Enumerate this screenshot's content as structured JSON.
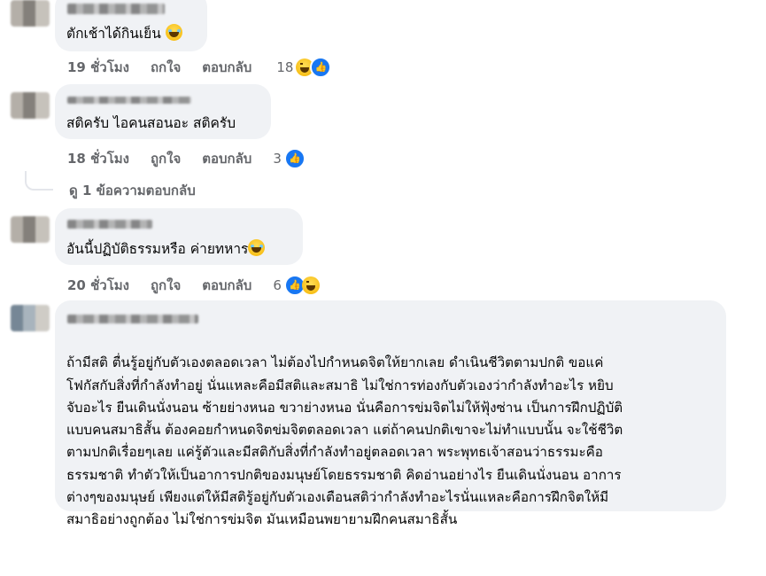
{
  "comments": [
    {
      "text": "ตักเช้าได้กินเย็น",
      "time": "19 ชั่วโมง",
      "like": "ถกใจ",
      "reply": "ตอบกลับ",
      "reactions_count": "18",
      "reactions": [
        "laugh-icon",
        "like-icon"
      ]
    },
    {
      "text": "สติครับ ไอคนสอนอะ สติครับ",
      "time": "18 ชั่วโมง",
      "like": "ถูกใจ",
      "reply": "ตอบกลับ",
      "reactions_count": "3",
      "reactions": [
        "like-icon"
      ]
    },
    {
      "text": "อันนี้ปฏิบัติธรรมหรือ ค่ายทหาร",
      "time": "20 ชั่วโมง",
      "like": "ถูกใจ",
      "reply": "ตอบกลับ",
      "reactions_count": "6",
      "reactions": [
        "like-icon",
        "laugh-icon"
      ]
    },
    {
      "lines": [
        "ถ้ามีสติ ตื่นรู้อยู่กับตัวเองตลอดเวลา ไม่ต้องไปกำหนดจิตให้ยากเลย ดำเนินชีวิตตามปกติ ขอแค่",
        "โฟกัสกับสิ่งที่กำลังทำอยู่ นั่นแหละคือมีสติและสมาธิ ไม่ใช่การท่องกับตัวเองว่ากำลังทำอะไร หยิบ",
        "จับอะไร ยืนเดินนั่งนอน ซ้ายย่างหนอ ขวาย่างหนอ นั่นคือการข่มจิตไม่ให้ฟุ้งซ่าน เป็นการฝึกปฏิบัติ",
        "แบบคนสมาธิสั้น ต้องคอยกำหนดจิตข่มจิตตลอดเวลา แต่ถ้าคนปกติเขาจะไม่ทำแบบนั้น จะใช้ชีวิต",
        "ตามปกติเรื่อยๆเลย แค่รู้ตัวและมีสติกับสิ่งที่กำลังทำอยู่ตลอดเวลา พระพุทธเจ้าสอนว่าธรรมะคือ",
        "ธรรมชาติ ทำตัวให้เป็นอาการปกติของมนุษย์โดยธรรมชาติ คิดอ่านอย่างไร ยืนเดินนั่งนอน อาการ",
        "ต่างๆของมนุษย์ เพียงแต่ให้มีสติรู้อยู่กับตัวเองเตือนสติว่ากำลังทำอะไรนั่นแหละคือการฝึกจิตให้มี",
        "สมาธิอย่างถูกต้อง ไม่ใช่การข่มจิต มันเหมือนพยายามฝึกคนสมาธิสั้น"
      ]
    }
  ],
  "view_replies": "ดู 1 ข้อความตอบกลับ",
  "colors": {
    "bubble": "#f0f2f5",
    "meta": "#65676b",
    "like_blue": "#1877f2"
  }
}
